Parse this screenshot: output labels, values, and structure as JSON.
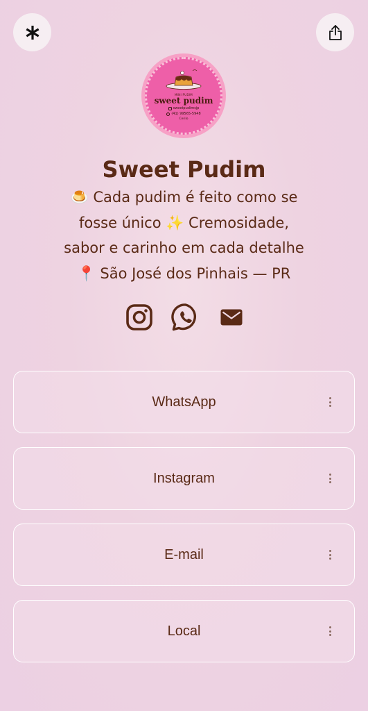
{
  "header": {
    "left_icon": "linktree-asterisk-icon",
    "right_icon": "share-icon"
  },
  "avatar": {
    "subtitle": "MINI PUDIM",
    "brand": "sweet pudim",
    "instagram_handle": "sweetpudimsjp",
    "phone": "(41) 99565-5948",
    "city": "Cerilo"
  },
  "profile": {
    "name": "Sweet Pudim",
    "bio_lines": [
      "🍮 Cada pudim é feito como se",
      "fosse único ✨ Cremosidade,",
      "sabor e carinho em cada detalhe",
      "📍 São José dos Pinhais — PR"
    ]
  },
  "socials": [
    {
      "icon": "instagram-icon"
    },
    {
      "icon": "whatsapp-icon"
    },
    {
      "icon": "envelope-icon"
    }
  ],
  "links": [
    {
      "label": "WhatsApp"
    },
    {
      "label": "Instagram"
    },
    {
      "label": "E-mail"
    },
    {
      "label": "Local"
    }
  ],
  "colors": {
    "text": "#5a2a16",
    "background": "#eed3e1",
    "avatar_ring": "#f7a1c6",
    "avatar_fill": "#ee5fa8"
  }
}
